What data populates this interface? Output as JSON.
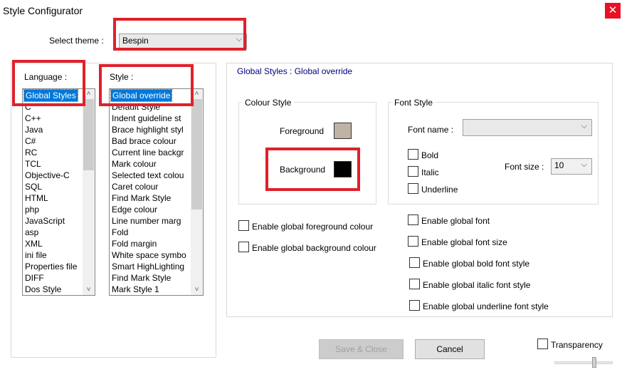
{
  "window": {
    "title": "Style Configurator",
    "close_glyph": "✕"
  },
  "theme": {
    "label": "Select theme :",
    "value": "Bespin"
  },
  "language": {
    "label": "Language :",
    "items": [
      "Global Styles",
      "C",
      "C++",
      "Java",
      "C#",
      "RC",
      "TCL",
      "Objective-C",
      "SQL",
      "HTML",
      "php",
      "JavaScript",
      "asp",
      "XML",
      "ini file",
      "Properties file",
      "DIFF",
      "Dos Style"
    ],
    "selected": "Global Styles"
  },
  "style": {
    "label": "Style :",
    "items": [
      "Global override",
      "Default Style",
      "Indent guideline st",
      "Brace highlight styl",
      "Bad brace colour",
      "Current line backgr",
      "Mark colour",
      "Selected text colou",
      "Caret colour",
      "Find Mark Style",
      "Edge colour",
      "Line number marg",
      "Fold",
      "Fold margin",
      "White space symbo",
      "Smart HighLighting",
      "Find Mark Style",
      "Mark Style 1"
    ],
    "selected": "Global override"
  },
  "panel_title": "Global Styles : Global override",
  "colour_style": {
    "label": "Colour Style",
    "foreground_label": "Foreground",
    "foreground_color": "#c0b3a4",
    "background_label": "Background",
    "background_color": "#000000"
  },
  "font_style": {
    "label": "Font Style",
    "font_name_label": "Font name :",
    "font_name_value": "",
    "bold": "Bold",
    "italic": "Italic",
    "underline": "Underline",
    "font_size_label": "Font size :",
    "font_size_value": "10"
  },
  "enable": {
    "fg": "Enable global foreground colour",
    "bg": "Enable global background colour",
    "font": "Enable global font",
    "font_size": "Enable global font size",
    "bold": "Enable global bold font style",
    "italic": "Enable global italic font style",
    "underline": "Enable global underline font style"
  },
  "buttons": {
    "save_close": "Save & Close",
    "cancel": "Cancel"
  },
  "transparency": {
    "label": "Transparency"
  },
  "colors": {
    "highlight_red": "#e0202a",
    "selection_blue": "#0078d7",
    "close_red": "#e81123"
  }
}
